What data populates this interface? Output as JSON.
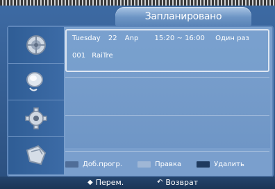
{
  "screen": {
    "title": "Запланировано"
  },
  "sidebar": {
    "items": [
      {
        "icon": "satellite-dish-icon"
      },
      {
        "icon": "speaker-icon"
      },
      {
        "icon": "gear-icon"
      },
      {
        "icon": "input-icon"
      }
    ]
  },
  "schedule": {
    "entries": [
      {
        "day": "Tuesday",
        "date": "22",
        "month": "Anp",
        "time": "15:20 ~ 16:00",
        "repeat": "Один раз",
        "channel_number": "001",
        "channel_name": "RaiTre"
      }
    ]
  },
  "legend": {
    "items": [
      {
        "color": "#4f6d98",
        "label": "Доб.прогр."
      },
      {
        "color": "#9fb7d6",
        "label": "Правка"
      },
      {
        "color": "#1e3a5f",
        "label": "Удалить"
      }
    ]
  },
  "bottom_bar": {
    "move_icon": "dpad-icon",
    "move_label": "Перем.",
    "return_icon": "return-icon",
    "return_label": "Возврат"
  }
}
